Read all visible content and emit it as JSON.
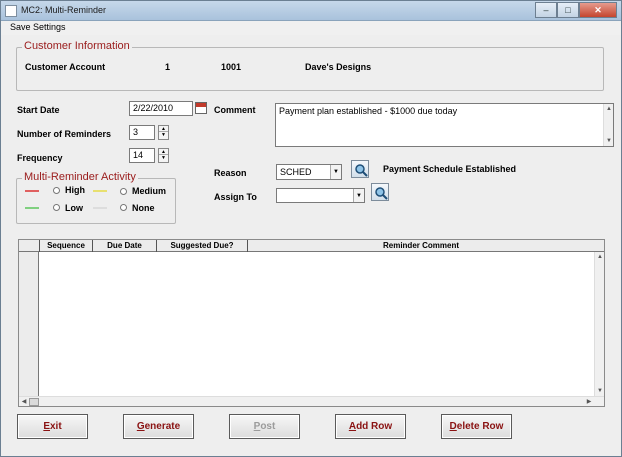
{
  "window": {
    "title": "MC2: Multi-Reminder",
    "min_glyph": "–",
    "max_glyph": "□",
    "close_glyph": "✕"
  },
  "menu": {
    "save_settings": "Save Settings"
  },
  "customer": {
    "legend": "Customer Information",
    "account_label": "Customer Account",
    "account_seq": "1",
    "account_number": "1001",
    "account_name": "Dave's Designs"
  },
  "form": {
    "start_date_label": "Start Date",
    "start_date": "2/22/2010",
    "reminders_label": "Number of Reminders",
    "reminders": "3",
    "frequency_label": "Frequency",
    "frequency": "14",
    "comment_label": "Comment",
    "comment": "Payment plan established - $1000 due today",
    "reason_label": "Reason",
    "reason_value": "SCHED",
    "reason_description": "Payment Schedule Established",
    "assign_label": "Assign To",
    "assign_value": ""
  },
  "activity": {
    "legend": "Multi-Reminder Activity",
    "high": "High",
    "medium": "Medium",
    "low": "Low",
    "none": "None",
    "colors": {
      "high": "#e06060",
      "medium": "#e8e070",
      "low": "#80d080",
      "none": "#dddddd"
    }
  },
  "grid": {
    "columns": [
      "Sequence",
      "Due Date",
      "Suggested Due?",
      "Reminder Comment"
    ],
    "rows": []
  },
  "buttons": {
    "exit_u": "E",
    "exit_rest": "xit",
    "generate_u": "G",
    "generate_rest": "enerate",
    "post_u": "P",
    "post_rest": "ost",
    "addrow_u": "A",
    "addrow_rest": "dd Row",
    "deleterow_u": "D",
    "deleterow_rest": "elete Row"
  }
}
